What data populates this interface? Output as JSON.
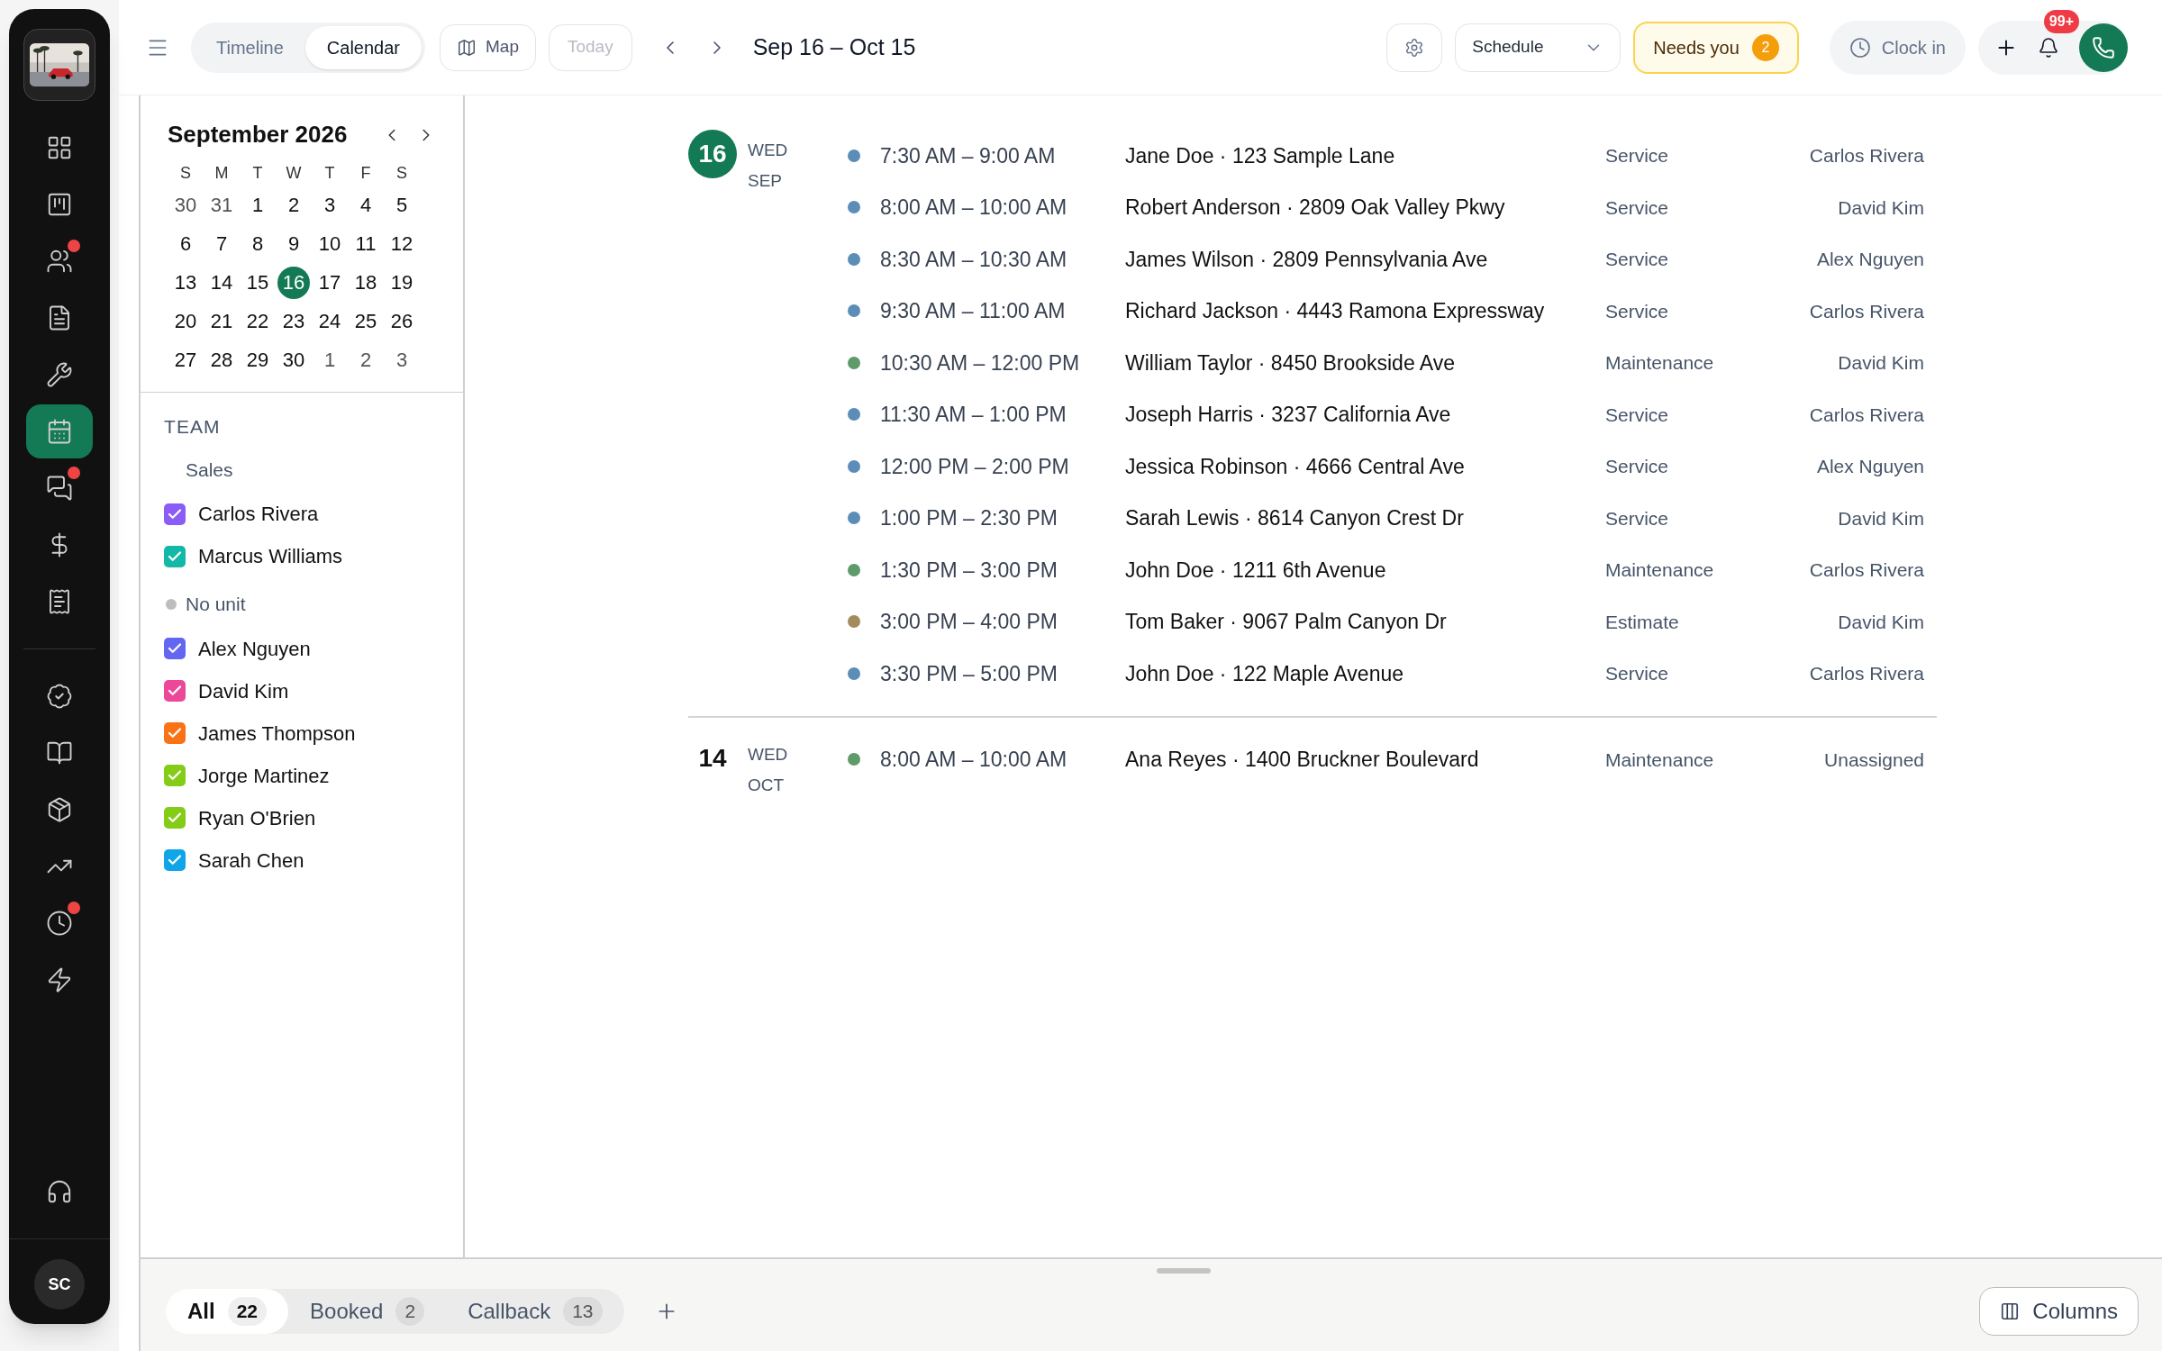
{
  "rail": {
    "top_items": [
      {
        "kind": "grid",
        "selected": false,
        "badge": false
      },
      {
        "kind": "board",
        "selected": false,
        "badge": false
      },
      {
        "kind": "people",
        "selected": false,
        "badge": true
      },
      {
        "kind": "document",
        "selected": false,
        "badge": false
      },
      {
        "kind": "wrench",
        "selected": false,
        "badge": false
      },
      {
        "kind": "calendar",
        "selected": true,
        "badge": false
      },
      {
        "kind": "chat",
        "selected": false,
        "badge": true
      },
      {
        "kind": "dollar",
        "selected": false,
        "badge": false
      },
      {
        "kind": "receipt",
        "selected": false,
        "badge": false
      }
    ],
    "middle_items": [
      {
        "kind": "badge-check",
        "selected": false,
        "badge": false
      },
      {
        "kind": "book",
        "selected": false,
        "badge": false
      },
      {
        "kind": "package",
        "selected": false,
        "badge": false
      },
      {
        "kind": "trend",
        "selected": false,
        "badge": false
      },
      {
        "kind": "clock",
        "selected": false,
        "badge": true
      },
      {
        "kind": "bolt",
        "selected": false,
        "badge": false
      }
    ],
    "bottom_items": [
      {
        "kind": "headset",
        "selected": false,
        "badge": false
      }
    ],
    "user_initials": "SC"
  },
  "toolbar": {
    "view_tabs": [
      {
        "label": "Timeline",
        "selected": false
      },
      {
        "label": "Calendar",
        "selected": true
      }
    ],
    "map_button": "Map",
    "today_button": {
      "label": "Today",
      "disabled": true
    },
    "date_range": "Sep 16 – Oct 15",
    "schedule_select": "Schedule",
    "needs_you": {
      "label": "Needs you",
      "count": "2"
    },
    "clock_in": "Clock in",
    "notifications": "99+"
  },
  "mini_calendar": {
    "title": "September 2026",
    "weekdays": [
      "S",
      "M",
      "T",
      "W",
      "T",
      "F",
      "S"
    ],
    "weeks": [
      [
        {
          "day": "30",
          "outside": true,
          "selected": false
        },
        {
          "day": "31",
          "outside": true,
          "selected": false
        },
        {
          "day": "1",
          "outside": false,
          "selected": false
        },
        {
          "day": "2",
          "outside": false,
          "selected": false
        },
        {
          "day": "3",
          "outside": false,
          "selected": false
        },
        {
          "day": "4",
          "outside": false,
          "selected": false
        },
        {
          "day": "5",
          "outside": false,
          "selected": false
        }
      ],
      [
        {
          "day": "6",
          "outside": false,
          "selected": false
        },
        {
          "day": "7",
          "outside": false,
          "selected": false
        },
        {
          "day": "8",
          "outside": false,
          "selected": false
        },
        {
          "day": "9",
          "outside": false,
          "selected": false
        },
        {
          "day": "10",
          "outside": false,
          "selected": false
        },
        {
          "day": "11",
          "outside": false,
          "selected": false
        },
        {
          "day": "12",
          "outside": false,
          "selected": false
        }
      ],
      [
        {
          "day": "13",
          "outside": false,
          "selected": false
        },
        {
          "day": "14",
          "outside": false,
          "selected": false
        },
        {
          "day": "15",
          "outside": false,
          "selected": false
        },
        {
          "day": "16",
          "outside": false,
          "selected": true
        },
        {
          "day": "17",
          "outside": false,
          "selected": false
        },
        {
          "day": "18",
          "outside": false,
          "selected": false
        },
        {
          "day": "19",
          "outside": false,
          "selected": false
        }
      ],
      [
        {
          "day": "20",
          "outside": false,
          "selected": false
        },
        {
          "day": "21",
          "outside": false,
          "selected": false
        },
        {
          "day": "22",
          "outside": false,
          "selected": false
        },
        {
          "day": "23",
          "outside": false,
          "selected": false
        },
        {
          "day": "24",
          "outside": false,
          "selected": false
        },
        {
          "day": "25",
          "outside": false,
          "selected": false
        },
        {
          "day": "26",
          "outside": false,
          "selected": false
        }
      ],
      [
        {
          "day": "27",
          "outside": false,
          "selected": false
        },
        {
          "day": "28",
          "outside": false,
          "selected": false
        },
        {
          "day": "29",
          "outside": false,
          "selected": false
        },
        {
          "day": "30",
          "outside": false,
          "selected": false
        },
        {
          "day": "1",
          "outside": true,
          "selected": false
        },
        {
          "day": "2",
          "outside": true,
          "selected": false
        },
        {
          "day": "3",
          "outside": true,
          "selected": false
        }
      ]
    ]
  },
  "team": {
    "title": "TEAM",
    "groups": [
      {
        "name": "Sales",
        "kind": "plain",
        "members": [
          {
            "name": "Carlos Rivera",
            "color": "#8b5cf6",
            "checked": true
          },
          {
            "name": "Marcus Williams",
            "color": "#14b8a6",
            "checked": true
          }
        ]
      },
      {
        "name": "No unit",
        "kind": "dot",
        "members": [
          {
            "name": "Alex Nguyen",
            "color": "#6366f1",
            "checked": true
          },
          {
            "name": "David Kim",
            "color": "#ec4899",
            "checked": true
          },
          {
            "name": "James Thompson",
            "color": "#f97316",
            "checked": true
          },
          {
            "name": "Jorge Martinez",
            "color": "#84cc16",
            "checked": true
          },
          {
            "name": "Ryan O'Brien",
            "color": "#84cc16",
            "checked": true
          },
          {
            "name": "Sarah Chen",
            "color": "#0ea5e9",
            "checked": true
          }
        ]
      }
    ]
  },
  "days": [
    {
      "day": "16",
      "weekday": "WED",
      "month": "SEP",
      "selected": true,
      "events": [
        {
          "time": "7:30 AM – 9:00 AM",
          "title": "Jane Doe · 123 Sample Lane",
          "type": "Service",
          "assignee": "Carlos Rivera",
          "color": "#5b8db8"
        },
        {
          "time": "8:00 AM – 10:00 AM",
          "title": "Robert Anderson · 2809 Oak Valley Pkwy",
          "type": "Service",
          "assignee": "David Kim",
          "color": "#5b8db8"
        },
        {
          "time": "8:30 AM – 10:30 AM",
          "title": "James Wilson · 2809 Pennsylvania Ave",
          "type": "Service",
          "assignee": "Alex Nguyen",
          "color": "#5b8db8"
        },
        {
          "time": "9:30 AM – 11:00 AM",
          "title": "Richard Jackson · 4443 Ramona Expressway",
          "type": "Service",
          "assignee": "Carlos Rivera",
          "color": "#5b8db8"
        },
        {
          "time": "10:30 AM – 12:00 PM",
          "title": "William Taylor · 8450 Brookside Ave",
          "type": "Maintenance",
          "assignee": "David Kim",
          "color": "#5e9a6a"
        },
        {
          "time": "11:30 AM – 1:00 PM",
          "title": "Joseph Harris · 3237 California Ave",
          "type": "Service",
          "assignee": "Carlos Rivera",
          "color": "#5b8db8"
        },
        {
          "time": "12:00 PM – 2:00 PM",
          "title": "Jessica Robinson · 4666 Central Ave",
          "type": "Service",
          "assignee": "Alex Nguyen",
          "color": "#5b8db8"
        },
        {
          "time": "1:00 PM – 2:30 PM",
          "title": "Sarah Lewis · 8614 Canyon Crest Dr",
          "type": "Service",
          "assignee": "David Kim",
          "color": "#5b8db8"
        },
        {
          "time": "1:30 PM – 3:00 PM",
          "title": "John Doe · 1211 6th Avenue",
          "type": "Maintenance",
          "assignee": "Carlos Rivera",
          "color": "#5e9a6a"
        },
        {
          "time": "3:00 PM – 4:00 PM",
          "title": "Tom Baker · 9067 Palm Canyon Dr",
          "type": "Estimate",
          "assignee": "David Kim",
          "color": "#a38b5e"
        },
        {
          "time": "3:30 PM – 5:00 PM",
          "title": "John Doe · 122 Maple Avenue",
          "type": "Service",
          "assignee": "Carlos Rivera",
          "color": "#5b8db8"
        }
      ]
    },
    {
      "day": "14",
      "weekday": "WED",
      "month": "OCT",
      "selected": false,
      "events": [
        {
          "time": "8:00 AM – 10:00 AM",
          "title": "Ana Reyes · 1400 Bruckner Boulevard",
          "type": "Maintenance",
          "assignee": "Unassigned",
          "color": "#5e9a6a"
        }
      ]
    }
  ],
  "bottom_bar": {
    "filters": [
      {
        "label": "All",
        "count": "22",
        "selected": true
      },
      {
        "label": "Booked",
        "count": "2",
        "selected": false
      },
      {
        "label": "Callback",
        "count": "13",
        "selected": false
      }
    ],
    "columns_button": "Columns"
  }
}
